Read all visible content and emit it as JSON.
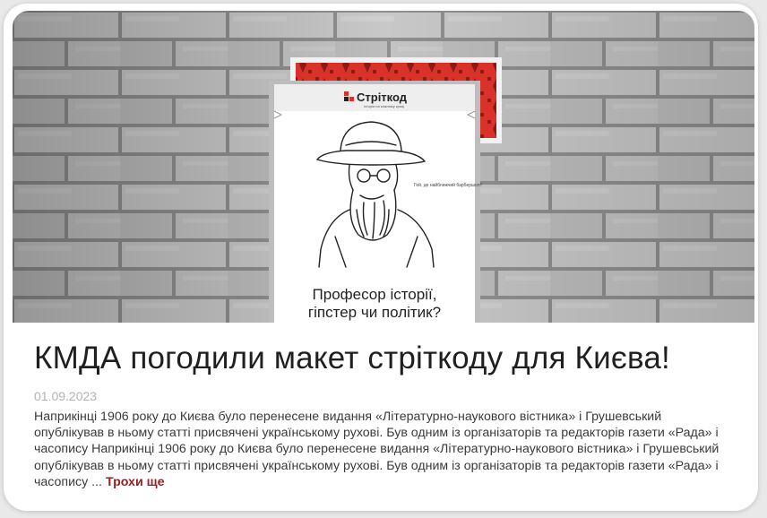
{
  "article": {
    "headline": "КМДА погодили макет стріткоду для Києва!",
    "date": "01.09.2023",
    "excerpt": "Наприкінці 1906 року до Києва було перенесене видання «Літературно-наукового вістника» і Грушевський опублікував в ньому статті присвячені українському рухові. Був одним із організаторів та редакторів газети «Рада» і часопису Наприкінці 1906 року до Києва було перенесене видання «Літературно-наукового вістника» і Грушевський опублікував в ньому статті присвячені українському рухові. Був одним із організаторів та редакторів газети «Рада» і часопису ...",
    "read_more": "Трохи ще"
  },
  "poster": {
    "brand": "Стріткод",
    "brand_subtitle": "історія на кожному кроці",
    "speech_bubble": "Гей, де найближчий барбершоп?",
    "caption_line1": "Професор історії,",
    "caption_line2": "гіпстер чи політик?"
  },
  "colors": {
    "ornament_red": "#d8322a",
    "read_more": "#9b1c1c",
    "wall": "#9a9a9a"
  }
}
